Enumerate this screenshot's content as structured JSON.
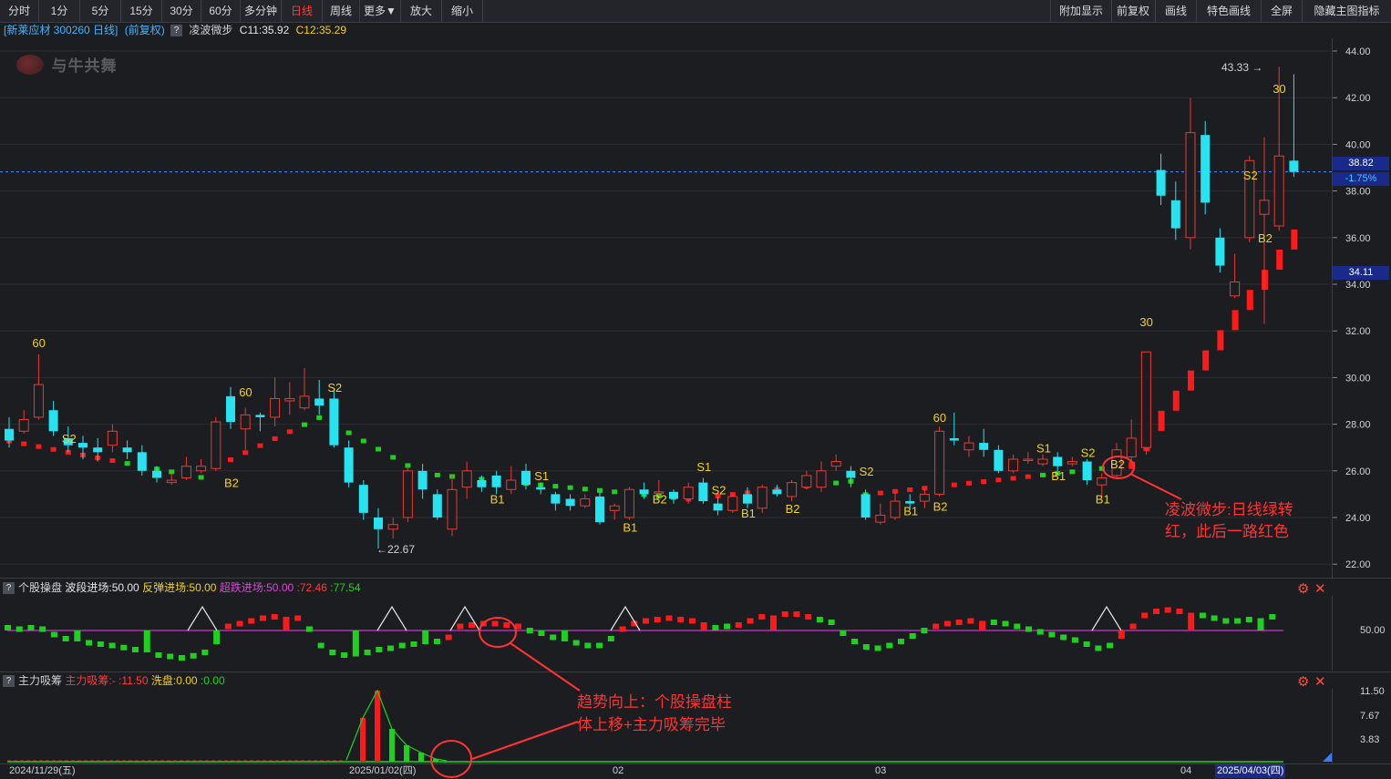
{
  "toolbar": {
    "tabs": [
      "分时",
      "1分",
      "5分",
      "15分",
      "30分",
      "60分",
      "多分钟",
      "日线",
      "周线",
      "更多▼",
      "放大",
      "缩小"
    ],
    "active_tab": "日线",
    "right": [
      "附加显示",
      "前复权",
      "画线",
      "特色画线",
      "全屏",
      "隐藏主图指标"
    ]
  },
  "header": {
    "stock": "[新莱应材 300260 日线]",
    "adjust": "(前复权)",
    "indicator": "凌波微步",
    "c1": "C11:35.92",
    "c2": "C12:35.29",
    "logo": "与牛共舞"
  },
  "axis": {
    "price_ticks": [
      "44.00",
      "42.00",
      "40.00",
      "38.00",
      "36.00",
      "34.00",
      "32.00",
      "30.00",
      "28.00",
      "26.00",
      "24.00",
      "22.00"
    ],
    "last_price": "38.82",
    "change_pct": "-1.75%",
    "level_tag": "34.11",
    "high_label": "43.33",
    "low_label": "22.67",
    "osc_tick": "50.00",
    "vol_ticks": [
      "11.50",
      "7.67",
      "3.83"
    ]
  },
  "dates": {
    "start": "2024/11/29(五)",
    "d1": "2025/01/02(四)",
    "m2": "02",
    "m3": "03",
    "m4": "04",
    "end": "2025/04/03(四)"
  },
  "panel2": {
    "name": "个股操盘",
    "p1": "波段进场:50.00",
    "p2": "反弹进场:50.00",
    "p3": "超跌进场:50.00",
    "p4": ":72.46",
    "p5": ":77.54"
  },
  "panel3": {
    "name": "主力吸筹",
    "p1": "主力吸筹:-",
    "p2": ":11.50",
    "p3": "洗盘:0.00",
    "p4": ":0.00"
  },
  "annotations": {
    "a1_line1": "凌波微步:日线绿转",
    "a1_line2": "红，此后一路红色",
    "a2_line1": "趋势向上：个股操盘柱",
    "a2_line2": "体上移+主力吸筹完毕"
  },
  "signal_labels": [
    "60",
    "S2",
    "60",
    "B2",
    "S2",
    "S1",
    "B1",
    "B1",
    "B2",
    "S1",
    "S2",
    "B1",
    "B2",
    "S2",
    "60",
    "B1",
    "B2",
    "S1",
    "B1",
    "S2",
    "B1",
    "B2",
    "30",
    "S2",
    "B2",
    "30"
  ],
  "colors": {
    "up": "#e63b35",
    "down": "#27e3f0",
    "signal": "#f2d21b",
    "ma_red": "#ff1a1a",
    "ma_green": "#20d020",
    "magenta": "#cc33cc",
    "annotation": "#ff3333"
  },
  "chart_data": {
    "type": "candlestick",
    "symbol": "300260",
    "ylim": [
      22,
      44
    ],
    "candles": [
      [
        27.8,
        27.3,
        28.3,
        27.0
      ],
      [
        27.7,
        28.2,
        28.6,
        27.6
      ],
      [
        28.3,
        29.7,
        31.0,
        28.2
      ],
      [
        28.6,
        27.7,
        29.0,
        27.5
      ],
      [
        27.4,
        27.1,
        27.9,
        26.8
      ],
      [
        27.2,
        27.0,
        27.5,
        26.5
      ],
      [
        27.0,
        26.8,
        27.4,
        26.4
      ],
      [
        27.1,
        27.7,
        28.0,
        26.8
      ],
      [
        27.0,
        26.8,
        27.3,
        26.5
      ],
      [
        26.8,
        26.0,
        27.1,
        25.8
      ],
      [
        26.0,
        25.7,
        26.2,
        25.5
      ],
      [
        25.5,
        25.6,
        25.9,
        25.4
      ],
      [
        25.7,
        26.2,
        26.6,
        25.6
      ],
      [
        26.0,
        26.2,
        26.5,
        25.9
      ],
      [
        26.1,
        28.1,
        28.3,
        26.0
      ],
      [
        29.2,
        28.1,
        29.6,
        27.8
      ],
      [
        27.8,
        28.4,
        28.7,
        26.9
      ],
      [
        28.4,
        28.3,
        28.5,
        27.7
      ],
      [
        28.3,
        29.1,
        30.0,
        27.9
      ],
      [
        29.0,
        29.1,
        29.8,
        28.4
      ],
      [
        28.7,
        29.2,
        30.4,
        28.6
      ],
      [
        29.1,
        28.8,
        29.9,
        28.4
      ],
      [
        29.1,
        27.1,
        29.5,
        27.0
      ],
      [
        27.0,
        25.5,
        27.3,
        25.3
      ],
      [
        25.4,
        24.2,
        25.6,
        23.9
      ],
      [
        24.0,
        23.5,
        24.4,
        22.67
      ],
      [
        23.5,
        23.7,
        24.0,
        23.1
      ],
      [
        24.0,
        26.0,
        26.2,
        23.8
      ],
      [
        26.0,
        25.2,
        26.3,
        24.8
      ],
      [
        25.0,
        24.0,
        25.2,
        23.9
      ],
      [
        23.5,
        25.2,
        25.8,
        23.2
      ],
      [
        25.3,
        26.0,
        26.4,
        24.8
      ],
      [
        25.6,
        25.3,
        25.8,
        25.1
      ],
      [
        25.8,
        25.3,
        26.0,
        25.0
      ],
      [
        25.2,
        25.6,
        26.2,
        25.0
      ],
      [
        26.0,
        25.4,
        26.3,
        25.2
      ],
      [
        25.3,
        25.2,
        25.5,
        25.0
      ],
      [
        25.0,
        24.6,
        25.1,
        24.3
      ],
      [
        24.8,
        24.5,
        25.0,
        24.3
      ],
      [
        24.5,
        24.8,
        25.0,
        24.4
      ],
      [
        24.9,
        23.8,
        25.1,
        23.7
      ],
      [
        24.3,
        24.5,
        24.6,
        23.9
      ],
      [
        24.0,
        25.2,
        25.3,
        23.9
      ],
      [
        25.2,
        25.0,
        25.5,
        24.8
      ],
      [
        25.1,
        25.1,
        25.6,
        24.9
      ],
      [
        25.1,
        24.8,
        25.2,
        24.6
      ],
      [
        24.8,
        25.3,
        25.5,
        24.6
      ],
      [
        25.5,
        24.7,
        25.7,
        24.6
      ],
      [
        24.6,
        24.3,
        24.9,
        24.1
      ],
      [
        24.3,
        24.9,
        25.0,
        24.2
      ],
      [
        25.0,
        24.6,
        25.3,
        24.4
      ],
      [
        24.4,
        25.3,
        25.4,
        24.2
      ],
      [
        25.2,
        25.0,
        25.4,
        24.9
      ],
      [
        24.9,
        25.5,
        25.6,
        24.7
      ],
      [
        25.3,
        25.8,
        26.0,
        25.2
      ],
      [
        25.3,
        26.0,
        26.4,
        25.1
      ],
      [
        26.2,
        26.4,
        26.7,
        26.0
      ],
      [
        26.0,
        25.7,
        26.2,
        25.3
      ],
      [
        25.0,
        24.0,
        25.2,
        23.9
      ],
      [
        23.8,
        24.1,
        24.6,
        23.7
      ],
      [
        24.0,
        24.7,
        25.1,
        23.9
      ],
      [
        24.7,
        24.6,
        25.0,
        24.4
      ],
      [
        24.7,
        25.0,
        25.2,
        24.4
      ],
      [
        25.0,
        27.7,
        27.9,
        24.9
      ],
      [
        27.4,
        27.3,
        28.5,
        27.1
      ],
      [
        26.9,
        27.2,
        27.5,
        26.6
      ],
      [
        27.2,
        26.9,
        27.8,
        26.6
      ],
      [
        26.9,
        26.0,
        27.1,
        25.9
      ],
      [
        26.0,
        26.5,
        26.7,
        25.9
      ],
      [
        26.5,
        26.5,
        26.8,
        26.3
      ],
      [
        26.3,
        26.5,
        26.7,
        26.2
      ],
      [
        26.6,
        26.2,
        26.8,
        26.0
      ],
      [
        26.3,
        26.4,
        26.6,
        26.2
      ],
      [
        26.4,
        25.6,
        26.5,
        25.4
      ],
      [
        25.4,
        25.7,
        25.9,
        24.9
      ],
      [
        25.8,
        26.9,
        27.2,
        25.7
      ],
      [
        26.6,
        27.4,
        28.2,
        26.4
      ],
      [
        27.0,
        31.1,
        31.1,
        26.7
      ],
      [
        38.9,
        37.8,
        39.6,
        37.4
      ],
      [
        37.6,
        36.4,
        38.4,
        35.9
      ],
      [
        36.0,
        40.5,
        42.0,
        35.5
      ],
      [
        40.4,
        37.5,
        41.0,
        37.0
      ],
      [
        36.0,
        34.8,
        36.4,
        34.5
      ],
      [
        33.5,
        34.1,
        35.3,
        33.4
      ],
      [
        36.0,
        39.3,
        39.5,
        35.8
      ],
      [
        37.0,
        37.6,
        40.3,
        32.3
      ],
      [
        36.5,
        39.5,
        43.33,
        36.3
      ],
      [
        39.3,
        38.82,
        43.0,
        38.6
      ]
    ]
  }
}
